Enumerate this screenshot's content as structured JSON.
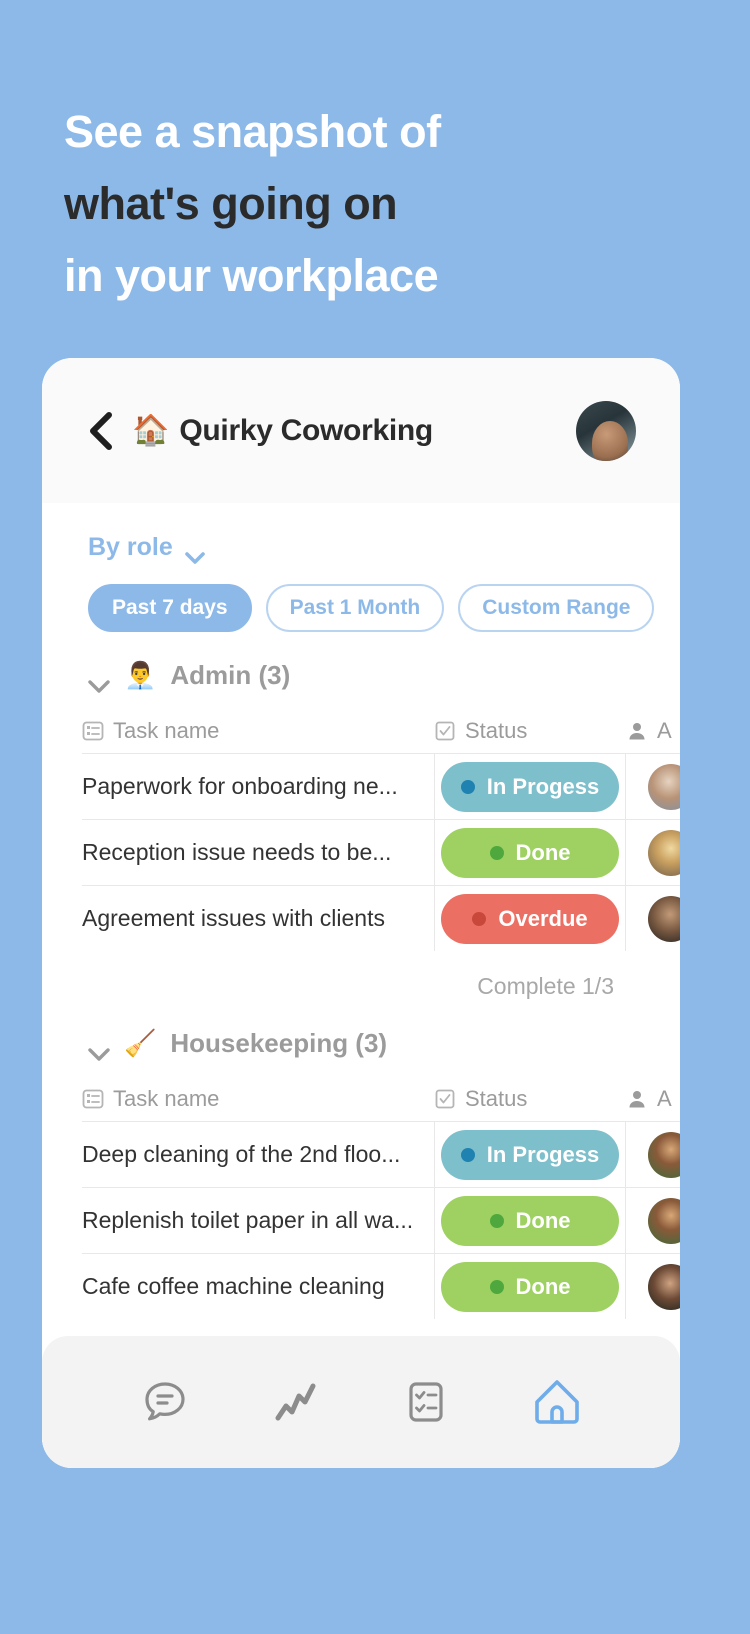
{
  "headline": {
    "line1": "See a snapshot of",
    "line2": "what's going on",
    "line3": "in your workplace"
  },
  "colors": {
    "background": "#8DB9E8",
    "accent": "#8DB9E8",
    "headline_white": "#FFFFFF",
    "headline_dark": "#2B2B2B",
    "status_in_progress": "#7EBFCC",
    "status_in_progress_dot": "#1F82B0",
    "status_done": "#9ED162",
    "status_done_dot": "#4FA83D",
    "status_overdue": "#EC6F63",
    "status_overdue_dot": "#C9483C"
  },
  "header": {
    "back_icon": "chevron-left-icon",
    "workspace_emoji": "🏠",
    "title": "Quirky Coworking",
    "avatar_icon": "user-avatar"
  },
  "filters": {
    "group_by_label": "By role",
    "group_by_icon": "chevron-down-icon",
    "ranges": [
      {
        "label": "Past 7 days",
        "active": true
      },
      {
        "label": "Past 1 Month",
        "active": false
      },
      {
        "label": "Custom Range",
        "active": false
      }
    ]
  },
  "table_columns": {
    "task": "Task name",
    "status": "Status",
    "assignee": "A",
    "task_icon": "list-form-icon",
    "status_icon": "checkbox-checked-icon",
    "assignee_icon": "person-icon"
  },
  "groups": [
    {
      "emoji": "👨‍💼",
      "name": "Admin (3)",
      "collapse_icon": "chevron-down-icon",
      "rows": [
        {
          "task": "Paperwork for onboarding ne...",
          "status": "In Progess",
          "status_type": "in_progress"
        },
        {
          "task": "Reception issue needs to be...",
          "status": "Done",
          "status_type": "done"
        },
        {
          "task": "Agreement issues with clients",
          "status": "Overdue",
          "status_type": "overdue"
        }
      ],
      "complete_label": "Complete 1/3"
    },
    {
      "emoji": "🧹",
      "name": "Housekeeping (3)",
      "collapse_icon": "chevron-down-icon",
      "rows": [
        {
          "task": "Deep cleaning of the 2nd floo...",
          "status": "In Progess",
          "status_type": "in_progress"
        },
        {
          "task": "Replenish toilet paper in all wa...",
          "status": "Done",
          "status_type": "done"
        },
        {
          "task": "Cafe coffee machine cleaning",
          "status": "Done",
          "status_type": "done"
        }
      ],
      "complete_label": ""
    }
  ],
  "bottom_nav": [
    {
      "icon": "chat-bubble-icon",
      "active": false
    },
    {
      "icon": "activity-zigzag-icon",
      "active": false
    },
    {
      "icon": "checklist-icon",
      "active": false
    },
    {
      "icon": "home-icon",
      "active": true
    }
  ]
}
